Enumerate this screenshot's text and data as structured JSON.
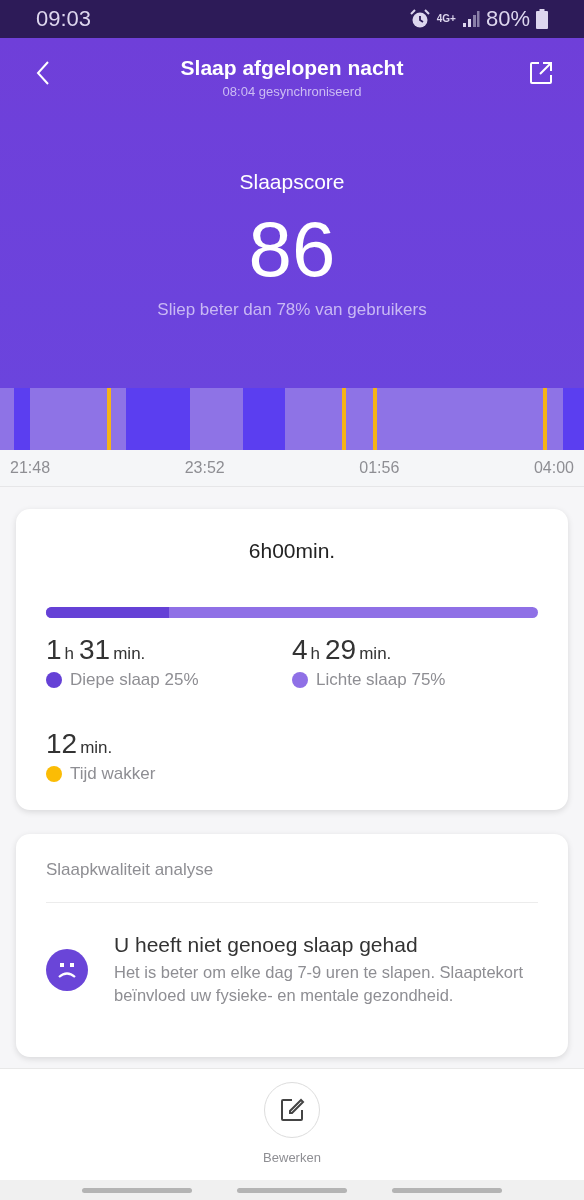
{
  "status_bar": {
    "time": "09:03",
    "network": "4G+",
    "battery": "80%"
  },
  "header": {
    "title": "Slaap afgelopen nacht",
    "subtitle": "08:04 gesynchroniseerd"
  },
  "score": {
    "label": "Slaapscore",
    "value": "86",
    "comparison": "Sliep beter dan 78% van gebruikers"
  },
  "timeline": {
    "times": [
      "21:48",
      "23:52",
      "01:56",
      "04:00"
    ]
  },
  "summary": {
    "total": "6h00min.",
    "progress": {
      "level": 0.25
    },
    "stats": [
      {
        "hours": "1",
        "hours_unit": "h",
        "minutes": "31",
        "minutes_unit": "min.",
        "label": "Diepe slaap 25%",
        "color": "#6541d6"
      },
      {
        "hours": "4",
        "hours_unit": "h",
        "minutes": "29",
        "minutes_unit": "min.",
        "label": "Lichte slaap 75%",
        "color": "#8f70e6"
      },
      {
        "minutes": "12",
        "minutes_unit": "min.",
        "label": "Tijd wakker",
        "color": "#fbbc05"
      }
    ]
  },
  "analysis": {
    "title": "Slaapkwaliteit analyse",
    "headline": "U heeft niet genoeg slaap gehad",
    "text": "Het is beter om elke dag 7-9 uren te slapen. Slaaptekort beïnvloed uw fysieke- en mentale gezondheid."
  },
  "footer": {
    "edit_label": "Bewerken"
  }
}
